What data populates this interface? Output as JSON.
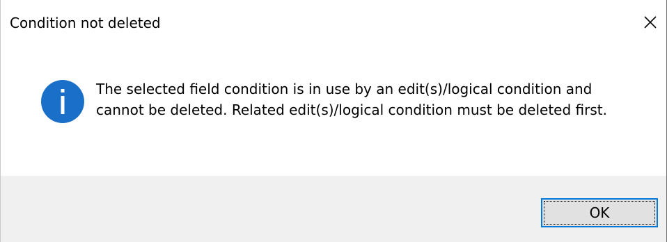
{
  "dialog": {
    "title": "Condition not deleted",
    "message": "The selected field condition is in use by an edit(s)/logical condition and cannot be deleted. Related edit(s)/logical condition must be deleted first.",
    "icon": "info-icon",
    "ok_label": "OK",
    "close_icon": "close-icon"
  },
  "colors": {
    "info_blue": "#1a6fc8",
    "button_focus_border": "#0078d7",
    "footer_background": "#f0f0f0"
  }
}
